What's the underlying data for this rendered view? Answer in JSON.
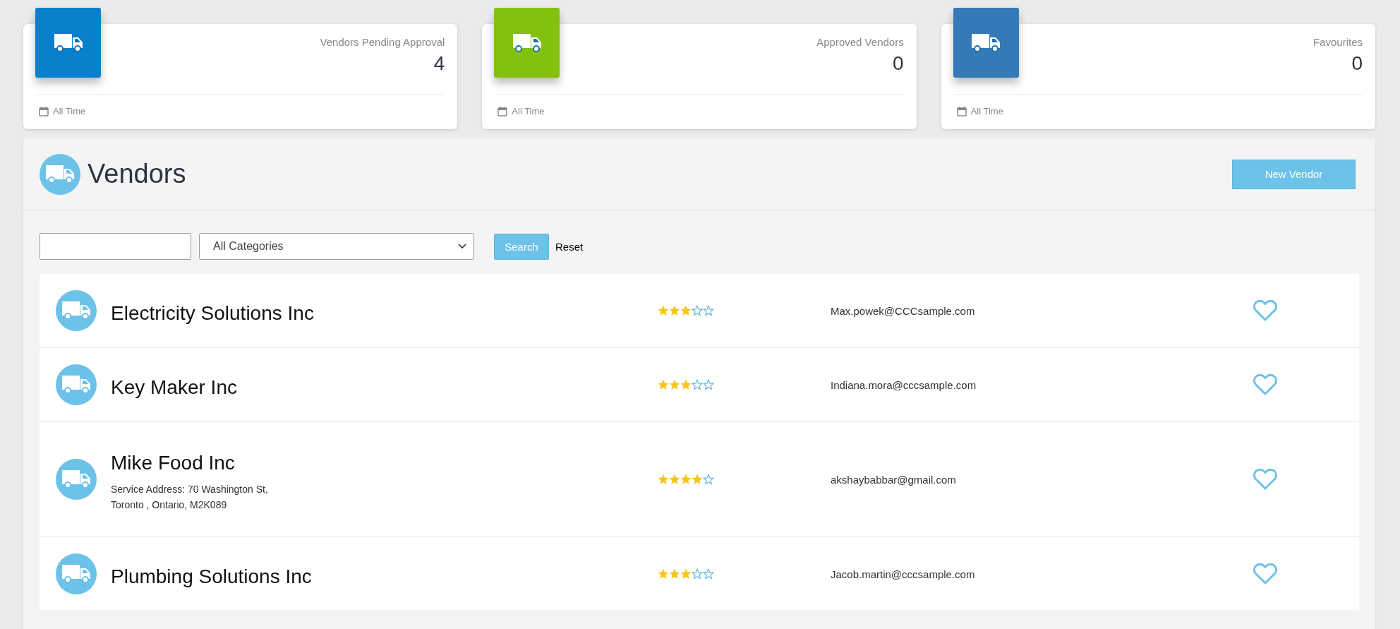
{
  "stat_cards": [
    {
      "title": "Vendors Pending Approval",
      "value": "4",
      "footer": "All Time",
      "color": "#0a7fcb"
    },
    {
      "title": "Approved Vendors",
      "value": "0",
      "footer": "All Time",
      "color": "#84c10f"
    },
    {
      "title": "Favourites",
      "value": "0",
      "footer": "All Time",
      "color": "#337ab7"
    }
  ],
  "vendors_panel": {
    "title": "Vendors",
    "new_button": "New Vendor",
    "search": {
      "category": "All Categories",
      "search_button": "Search",
      "reset_link": "Reset"
    },
    "vendors": [
      {
        "name": "Electricity Solutions Inc",
        "stars": 3,
        "email": "Max.powek@CCCsample.com",
        "favourite": false
      },
      {
        "name": "Key Maker Inc",
        "stars": 3,
        "email": "Indiana.mora@cccsample.com",
        "favourite": false
      },
      {
        "name": "Mike Food Inc",
        "address_lines": [
          "Service Address: 70 Washington St,",
          "Toronto , Ontario, M2K089"
        ],
        "stars": 4,
        "email": "akshaybabbar@gmail.com",
        "favourite": false
      },
      {
        "name": "Plumbing Solutions Inc",
        "stars": 3,
        "email": "Jacob.martin@cccsample.com",
        "favourite": false
      }
    ]
  }
}
